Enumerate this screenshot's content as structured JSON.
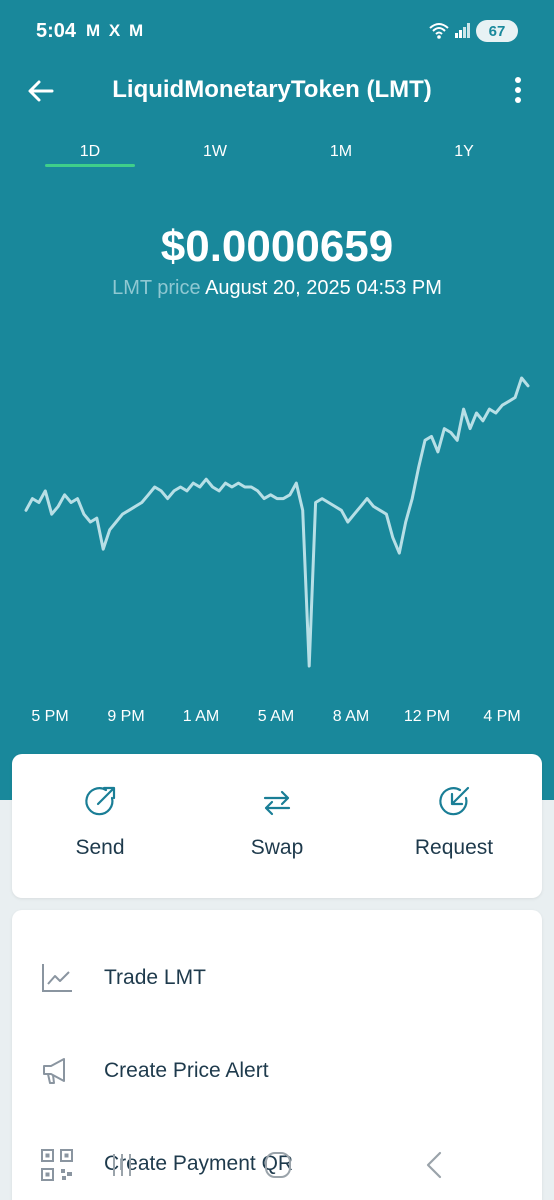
{
  "status_bar": {
    "time": "5:04",
    "notifications": "M X M",
    "battery": "67"
  },
  "header": {
    "title": "LiquidMonetaryToken (LMT)"
  },
  "tabs": [
    {
      "label": "1D",
      "active": true
    },
    {
      "label": "1W",
      "active": false
    },
    {
      "label": "1M",
      "active": false
    },
    {
      "label": "1Y",
      "active": false
    }
  ],
  "price": {
    "value": "$0.0000659",
    "label": "LMT price",
    "date": "August 20, 2025 04:53 PM"
  },
  "chart_data": {
    "type": "line",
    "x": [
      "5 PM",
      "9 PM",
      "1 AM",
      "5 AM",
      "8 AM",
      "12 PM",
      "4 PM"
    ],
    "series": [
      {
        "values": [
          5.85e-05,
          5.88e-05,
          5.87e-05,
          5.9e-05,
          5.84e-05,
          5.86e-05,
          5.89e-05,
          5.87e-05,
          5.88e-05,
          5.84e-05,
          5.82e-05,
          5.83e-05,
          5.75e-05,
          5.8e-05,
          5.82e-05,
          5.84e-05,
          5.85e-05,
          5.86e-05,
          5.87e-05,
          5.89e-05,
          5.91e-05,
          5.9e-05,
          5.88e-05,
          5.9e-05,
          5.91e-05,
          5.9e-05,
          5.92e-05,
          5.91e-05,
          5.93e-05,
          5.91e-05,
          5.9e-05,
          5.92e-05,
          5.91e-05,
          5.92e-05,
          5.91e-05,
          5.91e-05,
          5.9e-05,
          5.88e-05,
          5.89e-05,
          5.88e-05,
          5.88e-05,
          5.89e-05,
          5.92e-05,
          5.85e-05,
          5.45e-05,
          5.87e-05,
          5.88e-05,
          5.87e-05,
          5.86e-05,
          5.85e-05,
          5.82e-05,
          5.84e-05,
          5.86e-05,
          5.88e-05,
          5.86e-05,
          5.85e-05,
          5.84e-05,
          5.78e-05,
          5.74e-05,
          5.82e-05,
          5.88e-05,
          5.96e-05,
          6.03e-05,
          6.04e-05,
          6e-05,
          6.06e-05,
          6.05e-05,
          6.03e-05,
          6.11e-05,
          6.06e-05,
          6.1e-05,
          6.08e-05,
          6.11e-05,
          6.1e-05,
          6.12e-05,
          6.13e-05,
          6.14e-05,
          6.19e-05,
          6.17e-05
        ]
      }
    ],
    "xlabels": [
      "5 PM",
      "9 PM",
      "1 AM",
      "5 AM",
      "8 AM",
      "12 PM",
      "4 PM"
    ],
    "colors": {
      "line": "#b7dfe6",
      "background": "#19889b"
    }
  },
  "actions": [
    {
      "label": "Send",
      "icon": "send-icon"
    },
    {
      "label": "Swap",
      "icon": "swap-icon"
    },
    {
      "label": "Request",
      "icon": "request-icon"
    }
  ],
  "menu_items": [
    {
      "label": "Trade LMT",
      "icon": "chart-icon"
    },
    {
      "label": "Create Price Alert",
      "icon": "megaphone-icon"
    },
    {
      "label": "Create Payment QR",
      "icon": "qr-code-icon"
    }
  ],
  "colors": {
    "header_bg": "#19889b",
    "accent": "#3fcf8a",
    "text_dark": "#1e3a4c",
    "icon_blue": "#1a7e96"
  }
}
